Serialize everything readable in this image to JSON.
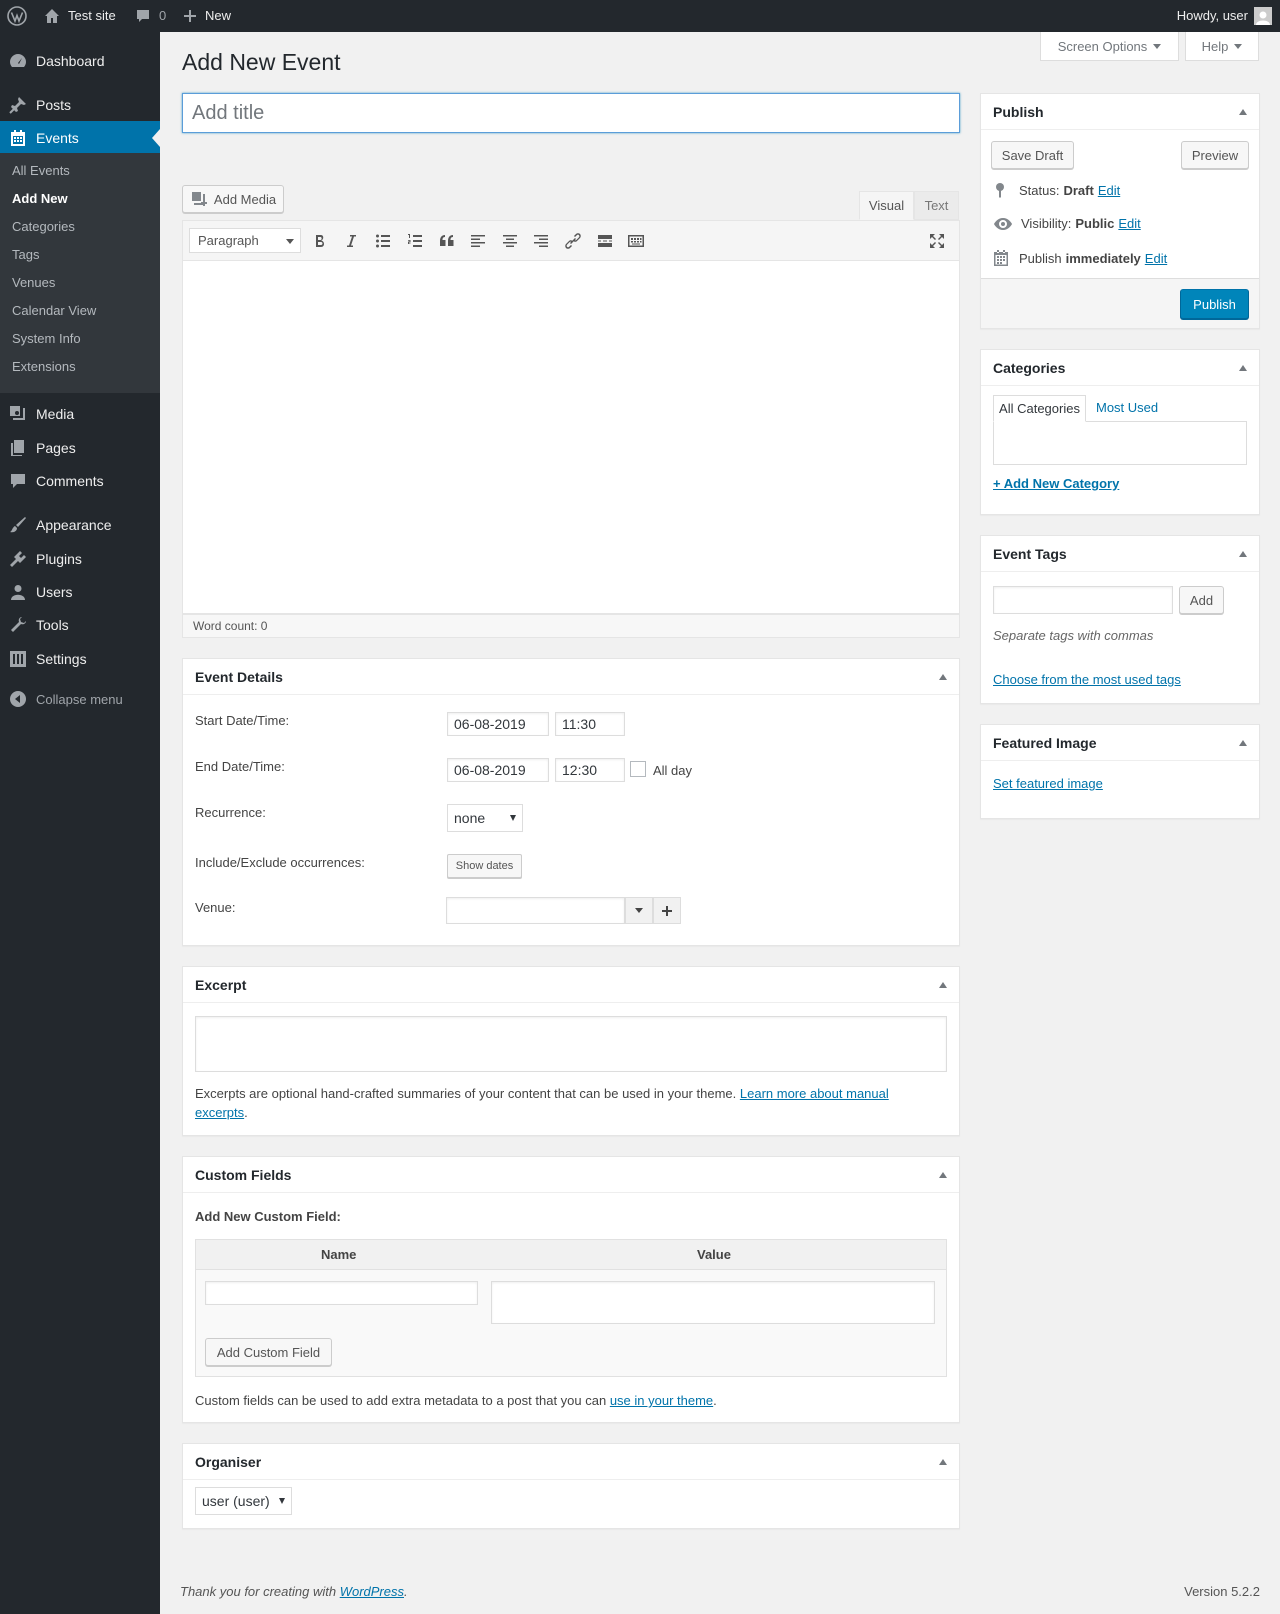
{
  "adminbar": {
    "site_name": "Test site",
    "comment_count": "0",
    "new_label": "New",
    "howdy": "Howdy, user"
  },
  "menu": {
    "dashboard": "Dashboard",
    "posts": "Posts",
    "events": "Events",
    "events_sub": [
      "All Events",
      "Add New",
      "Categories",
      "Tags",
      "Venues",
      "Calendar View",
      "System Info",
      "Extensions"
    ],
    "media": "Media",
    "pages": "Pages",
    "comments": "Comments",
    "appearance": "Appearance",
    "plugins": "Plugins",
    "users": "Users",
    "tools": "Tools",
    "settings": "Settings",
    "collapse": "Collapse menu"
  },
  "screen_options": "Screen Options",
  "help": "Help",
  "page_title": "Add New Event",
  "title_placeholder": "Add title",
  "editor": {
    "add_media": "Add Media",
    "tab_visual": "Visual",
    "tab_text": "Text",
    "format": "Paragraph",
    "word_count": "Word count: 0"
  },
  "event_details": {
    "heading": "Event Details",
    "start_label": "Start Date/Time:",
    "start_date": "06-08-2019",
    "start_time": "11:30",
    "end_label": "End Date/Time:",
    "end_date": "06-08-2019",
    "end_time": "12:30",
    "all_day": "All day",
    "recurrence_label": "Recurrence:",
    "recurrence_value": "none",
    "occurrences_label": "Include/Exclude occurrences:",
    "show_dates": "Show dates",
    "venue_label": "Venue:"
  },
  "excerpt": {
    "heading": "Excerpt",
    "desc": "Excerpts are optional hand-crafted summaries of your content that can be used in your theme.",
    "link1": "Learn more about manual",
    "link2": "excerpts"
  },
  "custom_fields": {
    "heading": "Custom Fields",
    "add_new": "Add New Custom Field:",
    "col_name": "Name",
    "col_value": "Value",
    "add_button": "Add Custom Field",
    "desc": "Custom fields can be used to add extra metadata to a post that you can",
    "desc_link": "use in your theme"
  },
  "organiser": {
    "heading": "Organiser",
    "value": "user (user)"
  },
  "publish": {
    "heading": "Publish",
    "save_draft": "Save Draft",
    "preview": "Preview",
    "status_label": "Status:",
    "status_value": "Draft",
    "visibility_label": "Visibility:",
    "visibility_value": "Public",
    "publish_label": "Publish",
    "publish_value": "immediately",
    "edit": "Edit",
    "publish_button": "Publish"
  },
  "categories": {
    "heading": "Categories",
    "tab_all": "All Categories",
    "tab_most": "Most Used",
    "add_new": "+ Add New Category"
  },
  "event_tags": {
    "heading": "Event Tags",
    "add": "Add",
    "hint": "Separate tags with commas",
    "choose": "Choose from the most used tags"
  },
  "featured_image": {
    "heading": "Featured Image",
    "set": "Set featured image"
  },
  "footer": {
    "thanks": "Thank you for creating with",
    "wordpress": "WordPress",
    "version": "Version 5.2.2"
  }
}
